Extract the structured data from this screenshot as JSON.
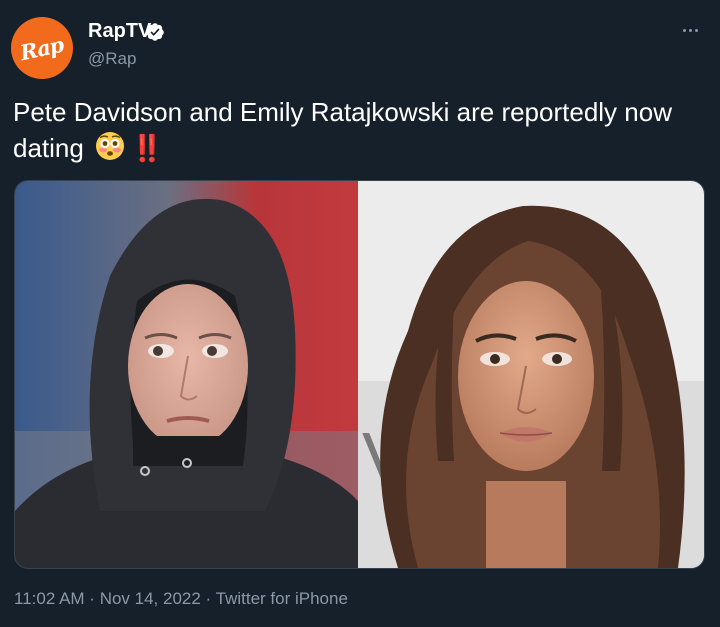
{
  "account": {
    "display_name": "RapTV",
    "handle": "@Rap",
    "avatar_text": "Rap",
    "verified": true
  },
  "tweet": {
    "text": "Pete Davidson and Emily Ratajkowski are reportedly now dating",
    "emoji": "flushed-face",
    "exclamation": "‼️",
    "exclamation_color": "#e0245e"
  },
  "media": {
    "images": [
      {
        "icon": "photo-man-in-hoodie"
      },
      {
        "icon": "photo-woman-portrait"
      }
    ]
  },
  "footer": {
    "time": "11:02 AM",
    "separator": " · ",
    "date": "Nov 14, 2022",
    "source": "Twitter for iPhone"
  },
  "colors": {
    "background": "#15202b",
    "secondary_text": "#8b98a5",
    "avatar": "#f26b1d",
    "verified": "#ffffff"
  }
}
